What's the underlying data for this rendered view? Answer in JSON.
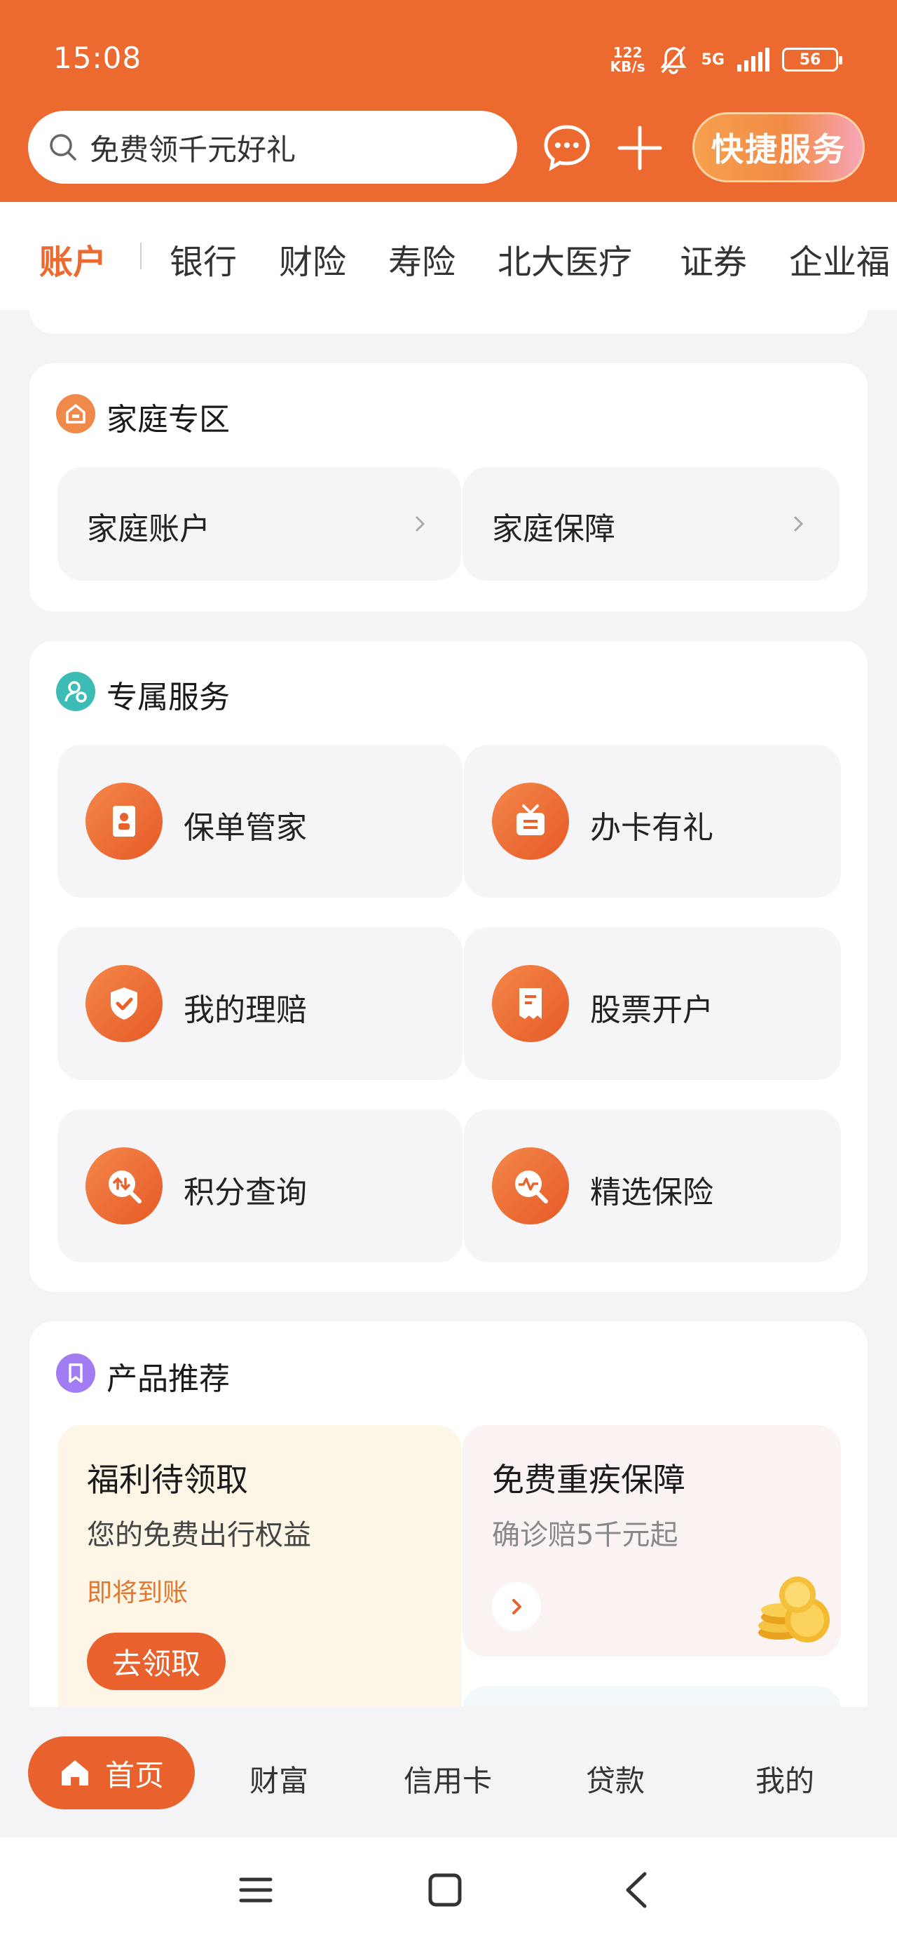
{
  "status_bar": {
    "time": "15:08",
    "net_speed_value": "122",
    "net_speed_unit": "KB/s",
    "network": "5G",
    "battery": "56"
  },
  "header": {
    "search_placeholder": "免费领千元好礼",
    "quick_service_label": "快捷服务",
    "accent_color": "#ec6a2f"
  },
  "tabs": [
    {
      "label": "账户",
      "active": true
    },
    {
      "label": "银行"
    },
    {
      "label": "财险"
    },
    {
      "label": "寿险"
    },
    {
      "label": "北大医疗"
    },
    {
      "label": "证券"
    },
    {
      "label": "企业福"
    }
  ],
  "family": {
    "title": "家庭专区",
    "items": [
      {
        "label": "家庭账户"
      },
      {
        "label": "家庭保障"
      }
    ]
  },
  "services": {
    "title": "专属服务",
    "items": [
      {
        "label": "保单管家",
        "icon": "policy-icon"
      },
      {
        "label": "办卡有礼",
        "icon": "gift-card-icon"
      },
      {
        "label": "我的理赔",
        "icon": "shield-check-icon"
      },
      {
        "label": "股票开户",
        "icon": "receipt-icon"
      },
      {
        "label": "积分查询",
        "icon": "points-search-icon"
      },
      {
        "label": "精选保险",
        "icon": "pulse-search-icon"
      }
    ]
  },
  "products": {
    "title": "产品推荐",
    "welfare": {
      "title": "福利待领取",
      "subtitle": "您的免费出行权益",
      "note": "即将到账",
      "button": "去领取"
    },
    "critical": {
      "title": "免费重疾保障",
      "subtitle": "确诊赔5千元起"
    }
  },
  "bottom_nav": [
    {
      "label": "首页",
      "active": true
    },
    {
      "label": "财富"
    },
    {
      "label": "信用卡"
    },
    {
      "label": "贷款"
    },
    {
      "label": "我的"
    }
  ]
}
